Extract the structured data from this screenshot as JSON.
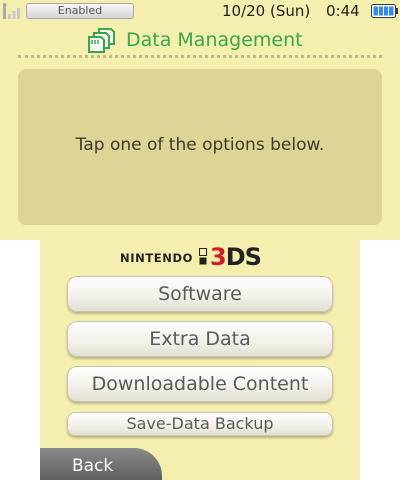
{
  "status_bar": {
    "wifi_label": "Enabled",
    "date": "10/20 (Sun)",
    "time": "0:44",
    "icons": [
      "signal-bars-icon",
      "battery-icon"
    ],
    "battery_color": "#2f8ef0"
  },
  "header": {
    "title": "Data Management",
    "title_color": "#3aa64a",
    "icon": "sd-cards-icon"
  },
  "message": {
    "text": "Tap one of the options below."
  },
  "logo": {
    "brand": "NINTENDO",
    "number": "3",
    "suffix": "DS"
  },
  "menu": {
    "software": "Software",
    "extra_data": "Extra Data",
    "downloadable_content": "Downloadable Content",
    "save_data_backup": "Save-Data Backup"
  },
  "footer": {
    "back_label": "Back"
  }
}
